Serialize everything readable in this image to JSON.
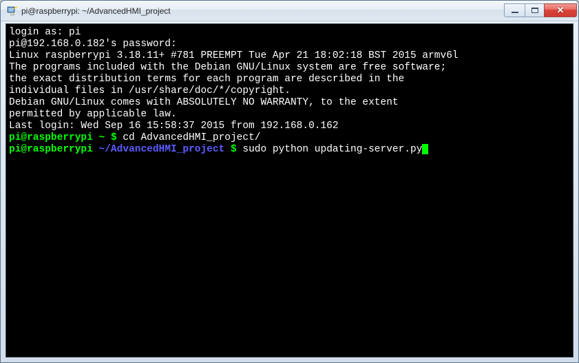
{
  "window": {
    "title": "pi@raspberrypi: ~/AdvancedHMI_project"
  },
  "terminal": {
    "lines": [
      "login as: pi",
      "pi@192.168.0.182's password:",
      "Linux raspberrypi 3.18.11+ #781 PREEMPT Tue Apr 21 18:02:18 BST 2015 armv6l",
      "",
      "The programs included with the Debian GNU/Linux system are free software;",
      "the exact distribution terms for each program are described in the",
      "individual files in /usr/share/doc/*/copyright.",
      "",
      "Debian GNU/Linux comes with ABSOLUTELY NO WARRANTY, to the extent",
      "permitted by applicable law.",
      "Last login: Wed Sep 16 15:58:37 2015 from 192.168.0.162"
    ],
    "prompt1": {
      "userhost": "pi@raspberrypi",
      "tilde": " ~ ",
      "dollar": "$ ",
      "cmd": "cd AdvancedHMI_project/"
    },
    "prompt2": {
      "userhost": "pi@raspberrypi",
      "sep": " ",
      "path": "~/AdvancedHMI_project",
      "dollar": " $ ",
      "cmd": "sudo python updating-server.py"
    }
  }
}
